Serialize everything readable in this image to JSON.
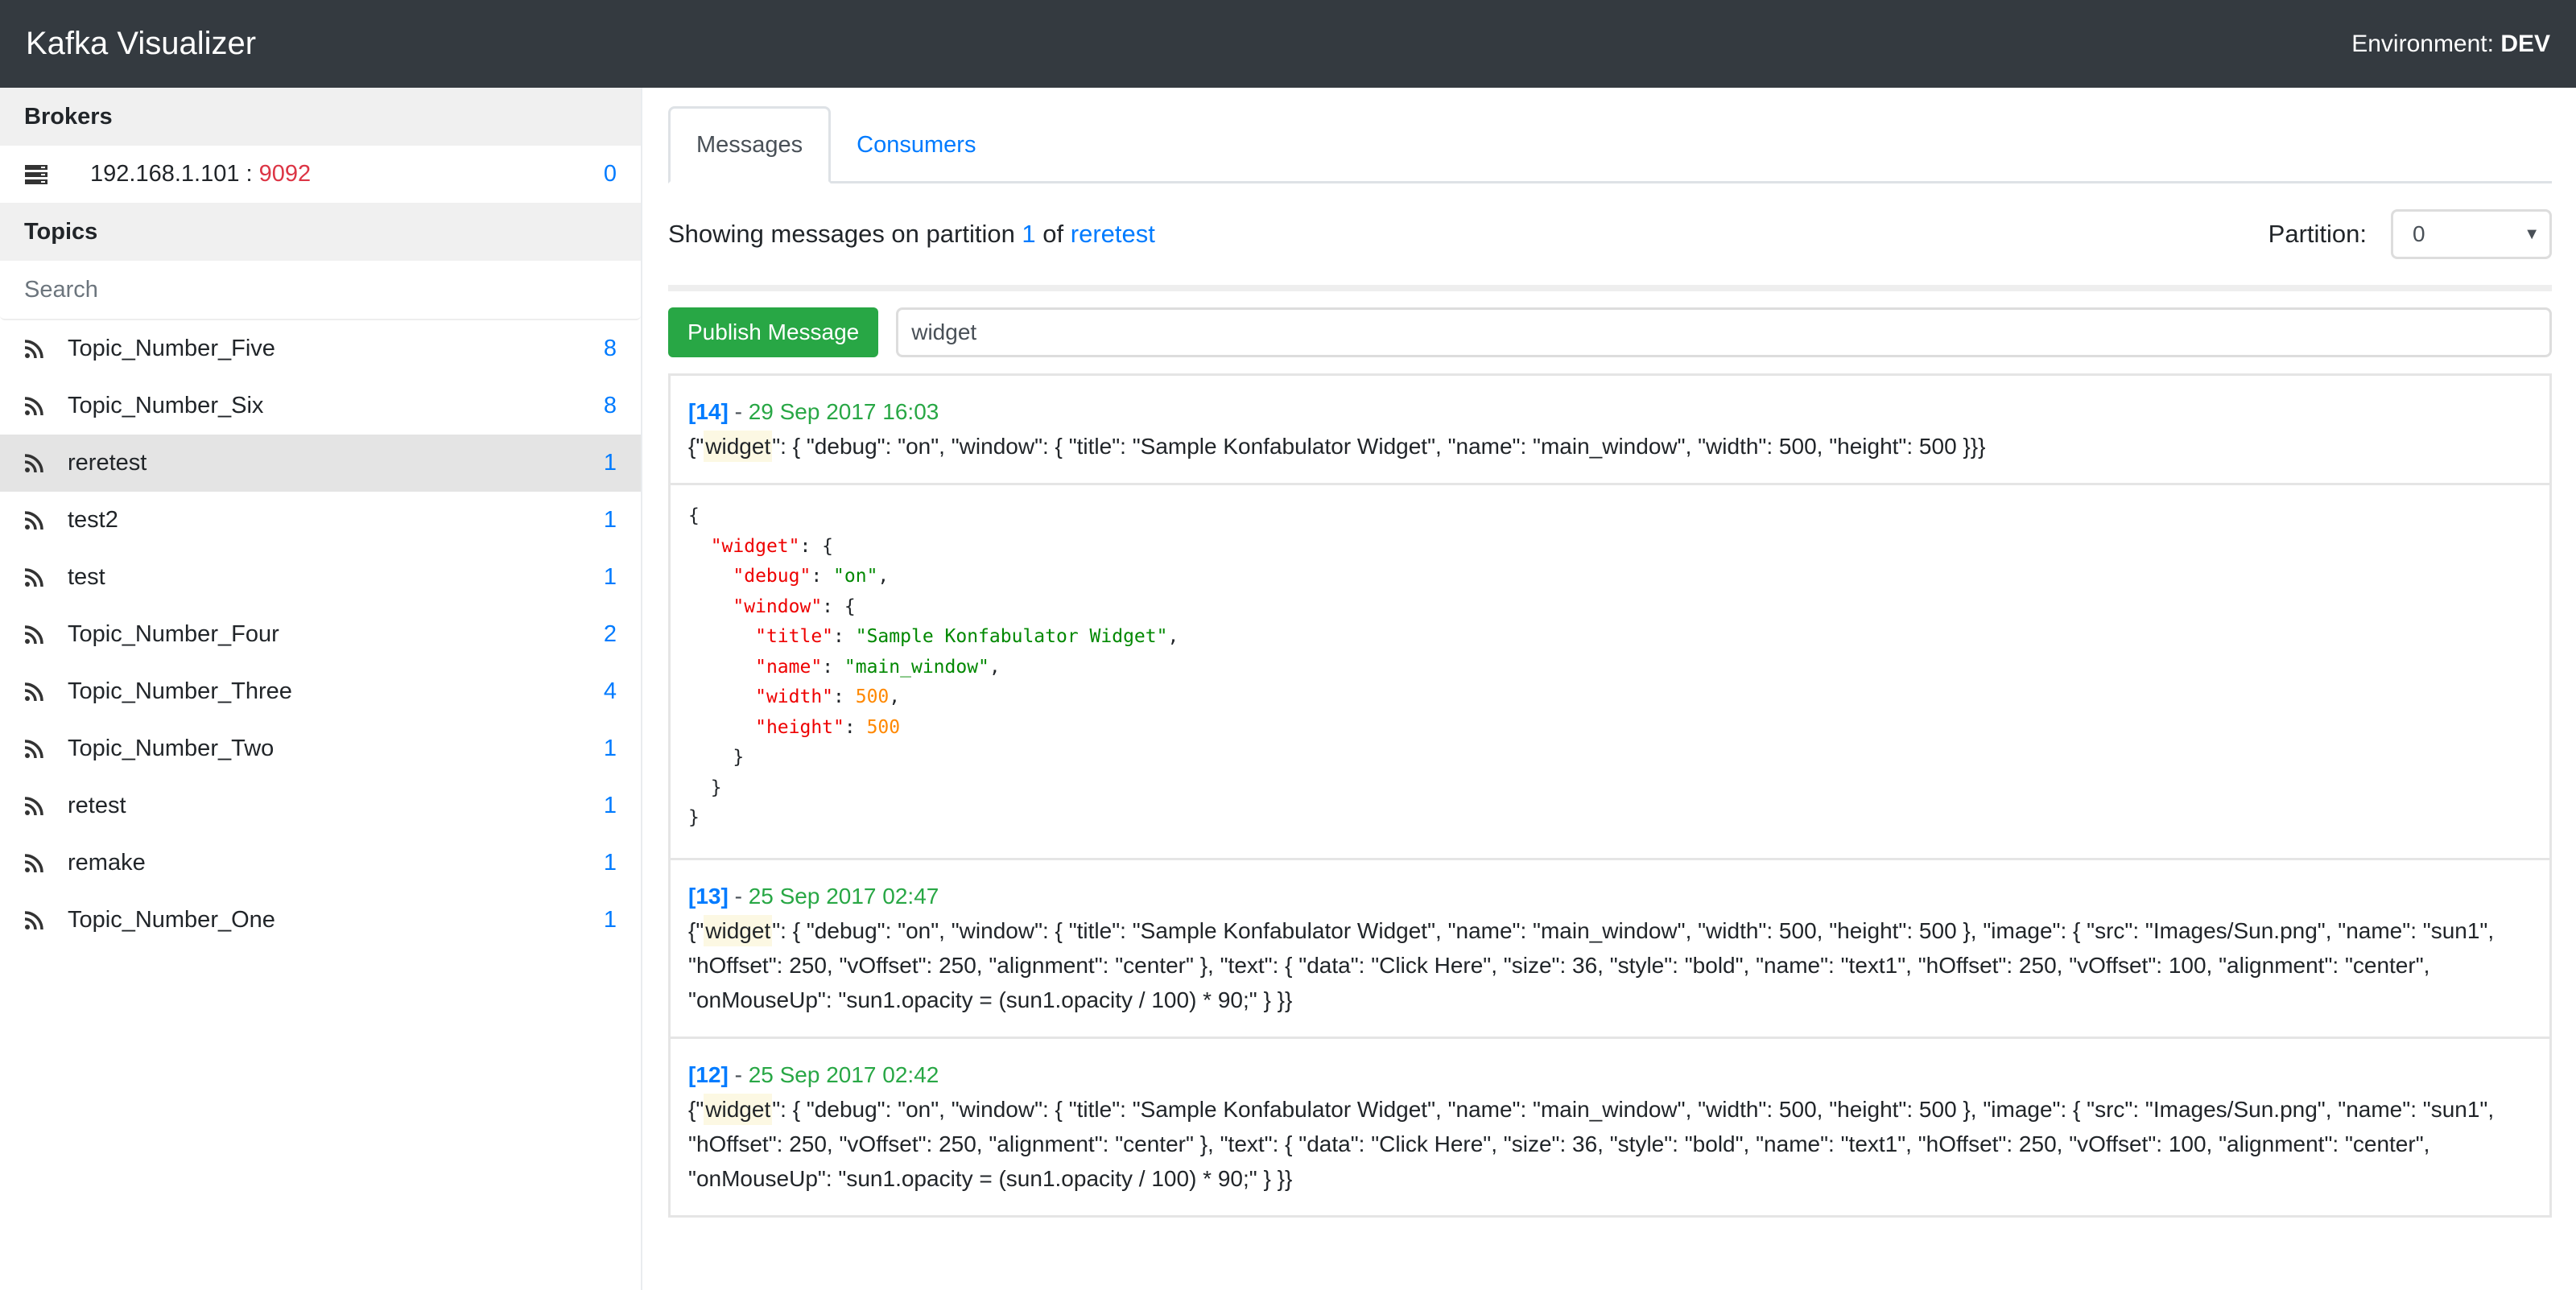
{
  "navbar": {
    "brand": "Kafka Visualizer",
    "env_label": "Environment:",
    "env_value": "DEV"
  },
  "sidebar": {
    "brokers_header": "Brokers",
    "brokers": [
      {
        "host": "192.168.1.101",
        "sep": " : ",
        "port": "9092",
        "count": "0"
      }
    ],
    "topics_header": "Topics",
    "search_placeholder": "Search",
    "topics": [
      {
        "name": "Topic_Number_Five",
        "count": "8"
      },
      {
        "name": "Topic_Number_Six",
        "count": "8"
      },
      {
        "name": "reretest",
        "count": "1",
        "active": true
      },
      {
        "name": "test2",
        "count": "1"
      },
      {
        "name": "test",
        "count": "1"
      },
      {
        "name": "Topic_Number_Four",
        "count": "2"
      },
      {
        "name": "Topic_Number_Three",
        "count": "4"
      },
      {
        "name": "Topic_Number_Two",
        "count": "1"
      },
      {
        "name": "retest",
        "count": "1"
      },
      {
        "name": "remake",
        "count": "1"
      },
      {
        "name": "Topic_Number_One",
        "count": "1"
      }
    ]
  },
  "main": {
    "tabs": [
      {
        "label": "Messages",
        "active": true
      },
      {
        "label": "Consumers",
        "active": false
      }
    ],
    "info": {
      "prefix": "Showing messages on partition ",
      "partition": "1",
      "middle": " of ",
      "topic": "reretest"
    },
    "partition_label": "Partition:",
    "partition_value": "0",
    "publish_label": "Publish Message",
    "filter_value": "widget",
    "messages": [
      {
        "offset": "[14]",
        "sep": " - ",
        "time": "29 Sep 2017 16:03",
        "pre": "{\"",
        "highlight": "widget",
        "body": "\": { \"debug\": \"on\", \"window\": { \"title\": \"Sample Konfabulator Widget\", \"name\": \"main_window\", \"width\": 500, \"height\": 500 }}}",
        "expanded": true
      },
      {
        "offset": "[13]",
        "sep": " - ",
        "time": "25 Sep 2017 02:47",
        "pre": "{\"",
        "highlight": "widget",
        "body": "\": { \"debug\": \"on\", \"window\": { \"title\": \"Sample Konfabulator Widget\", \"name\": \"main_window\", \"width\": 500, \"height\": 500 }, \"image\": { \"src\": \"Images/Sun.png\", \"name\": \"sun1\", \"hOffset\": 250, \"vOffset\": 250, \"alignment\": \"center\" }, \"text\": { \"data\": \"Click Here\", \"size\": 36, \"style\": \"bold\", \"name\": \"text1\", \"hOffset\": 250, \"vOffset\": 100, \"alignment\": \"center\", \"onMouseUp\": \"sun1.opacity = (sun1.opacity / 100) * 90;\" } }}",
        "expanded": false
      },
      {
        "offset": "[12]",
        "sep": " - ",
        "time": "25 Sep 2017 02:42",
        "pre": "{\"",
        "highlight": "widget",
        "body": "\": { \"debug\": \"on\", \"window\": { \"title\": \"Sample Konfabulator Widget\", \"name\": \"main_window\", \"width\": 500, \"height\": 500 }, \"image\": { \"src\": \"Images/Sun.png\", \"name\": \"sun1\", \"hOffset\": 250, \"vOffset\": 250, \"alignment\": \"center\" }, \"text\": { \"data\": \"Click Here\", \"size\": 36, \"style\": \"bold\", \"name\": \"text1\", \"hOffset\": 250, \"vOffset\": 100, \"alignment\": \"center\", \"onMouseUp\": \"sun1.opacity = (sun1.opacity / 100) * 90;\" } }}",
        "expanded": false
      }
    ],
    "expanded_json": [
      [
        {
          "t": "p",
          "v": "{"
        }
      ],
      [
        {
          "t": "p",
          "v": "  "
        },
        {
          "t": "k",
          "v": "\"widget\""
        },
        {
          "t": "p",
          "v": ": {"
        }
      ],
      [
        {
          "t": "p",
          "v": "    "
        },
        {
          "t": "k",
          "v": "\"debug\""
        },
        {
          "t": "p",
          "v": ": "
        },
        {
          "t": "s",
          "v": "\"on\""
        },
        {
          "t": "p",
          "v": ","
        }
      ],
      [
        {
          "t": "p",
          "v": "    "
        },
        {
          "t": "k",
          "v": "\"window\""
        },
        {
          "t": "p",
          "v": ": {"
        }
      ],
      [
        {
          "t": "p",
          "v": "      "
        },
        {
          "t": "k",
          "v": "\"title\""
        },
        {
          "t": "p",
          "v": ": "
        },
        {
          "t": "s",
          "v": "\"Sample Konfabulator Widget\""
        },
        {
          "t": "p",
          "v": ","
        }
      ],
      [
        {
          "t": "p",
          "v": "      "
        },
        {
          "t": "k",
          "v": "\"name\""
        },
        {
          "t": "p",
          "v": ": "
        },
        {
          "t": "s",
          "v": "\"main_window\""
        },
        {
          "t": "p",
          "v": ","
        }
      ],
      [
        {
          "t": "p",
          "v": "      "
        },
        {
          "t": "k",
          "v": "\"width\""
        },
        {
          "t": "p",
          "v": ": "
        },
        {
          "t": "n",
          "v": "500"
        },
        {
          "t": "p",
          "v": ","
        }
      ],
      [
        {
          "t": "p",
          "v": "      "
        },
        {
          "t": "k",
          "v": "\"height\""
        },
        {
          "t": "p",
          "v": ": "
        },
        {
          "t": "n",
          "v": "500"
        }
      ],
      [
        {
          "t": "p",
          "v": "    }"
        }
      ],
      [
        {
          "t": "p",
          "v": "  }"
        }
      ],
      [
        {
          "t": "p",
          "v": "}"
        }
      ]
    ]
  },
  "colors": {
    "navbar_bg": "#343a40",
    "link": "#007bff",
    "port": "#dc3545",
    "success": "#28a745",
    "json_key": "#ee0000",
    "json_string": "#008800",
    "json_number": "#ff8800"
  },
  "icons": {
    "broker": "server-icon",
    "topic": "rss-icon"
  }
}
